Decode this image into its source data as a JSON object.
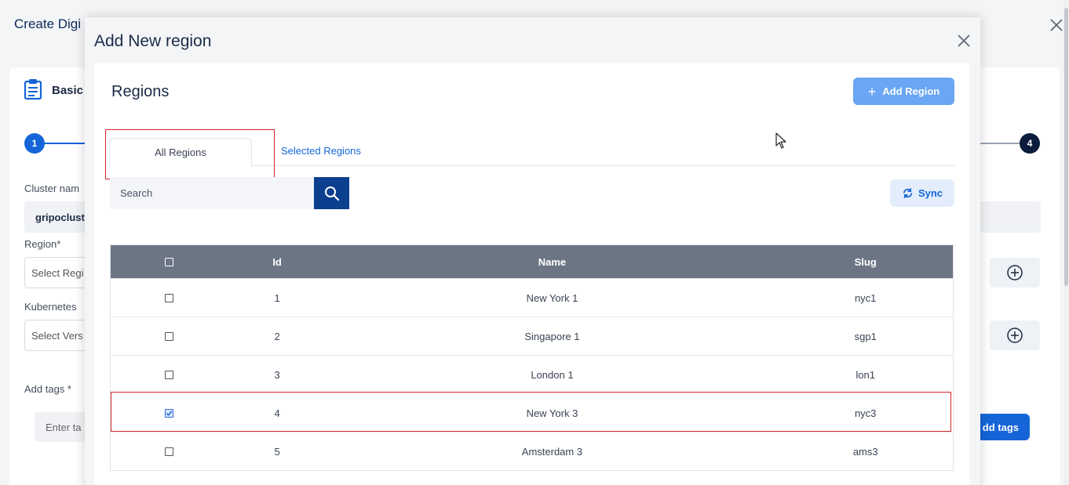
{
  "background": {
    "title": "Create Digi",
    "basic_label": "Basic",
    "step_first": "1",
    "step_last": "4",
    "cluster_name_label": "Cluster nam",
    "cluster_name_value": "gripoclust",
    "region_label": "Region*",
    "region_placeholder": "Select Regi",
    "kubernetes_label": "Kubernetes",
    "version_placeholder": "Select Vers",
    "add_tags_label": "Add tags *",
    "tags_placeholder": "Enter ta",
    "add_tags_button": "dd tags"
  },
  "modal": {
    "title": "Add New region",
    "panel_title": "Regions",
    "add_region_button": "Add Region",
    "tabs": [
      {
        "label": "All Regions",
        "active": true
      },
      {
        "label": "Selected Regions",
        "active": false
      }
    ],
    "search_placeholder": "Search",
    "sync_button": "Sync",
    "table": {
      "columns": [
        "Id",
        "Name",
        "Slug"
      ],
      "rows": [
        {
          "id": "1",
          "name": "New York 1",
          "slug": "nyc1",
          "checked": false
        },
        {
          "id": "2",
          "name": "Singapore 1",
          "slug": "sgp1",
          "checked": false
        },
        {
          "id": "3",
          "name": "London 1",
          "slug": "lon1",
          "checked": false
        },
        {
          "id": "4",
          "name": "New York 3",
          "slug": "nyc3",
          "checked": true
        },
        {
          "id": "5",
          "name": "Amsterdam 3",
          "slug": "ams3",
          "checked": false
        }
      ]
    }
  },
  "colors": {
    "primary": "#1565d8",
    "navy": "#0d3f8f",
    "header_gray": "#6c7584",
    "highlight_red": "#d62828"
  }
}
